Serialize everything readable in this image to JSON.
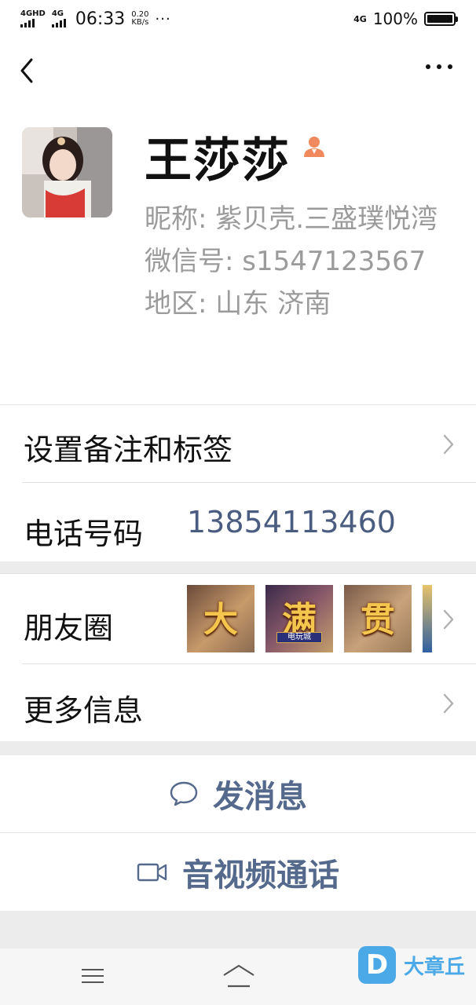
{
  "status_bar": {
    "sim1": "4GHD",
    "sim2": "4G",
    "time": "06:33",
    "speed_value": "0.20",
    "speed_unit": "KB/s",
    "more_dots": "···",
    "network": "4G",
    "battery_text": "100%",
    "battery_level": 1.0
  },
  "profile": {
    "name": "王莎莎",
    "nickname": "昵称: 紫贝壳.三盛璞悦湾",
    "wechat_id": "微信号: s1547123567",
    "region": "地区: 山东  济南"
  },
  "rows": {
    "remark_label": "设置备注和标签",
    "phone_label": "电话号码",
    "phone_value": "13854113460",
    "moments_label": "朋友圈",
    "moments_thumbs": [
      "大",
      "满",
      "贯"
    ],
    "moments_thumb_sub": "电玩城",
    "more_info_label": "更多信息"
  },
  "actions": {
    "message": "发消息",
    "call": "音视频通话"
  },
  "watermark": {
    "logo_letter": "D",
    "text": "大章丘"
  },
  "colors": {
    "accent": "#55698c",
    "link": "#4a5d80",
    "secondary_text": "#9b9b9b"
  }
}
